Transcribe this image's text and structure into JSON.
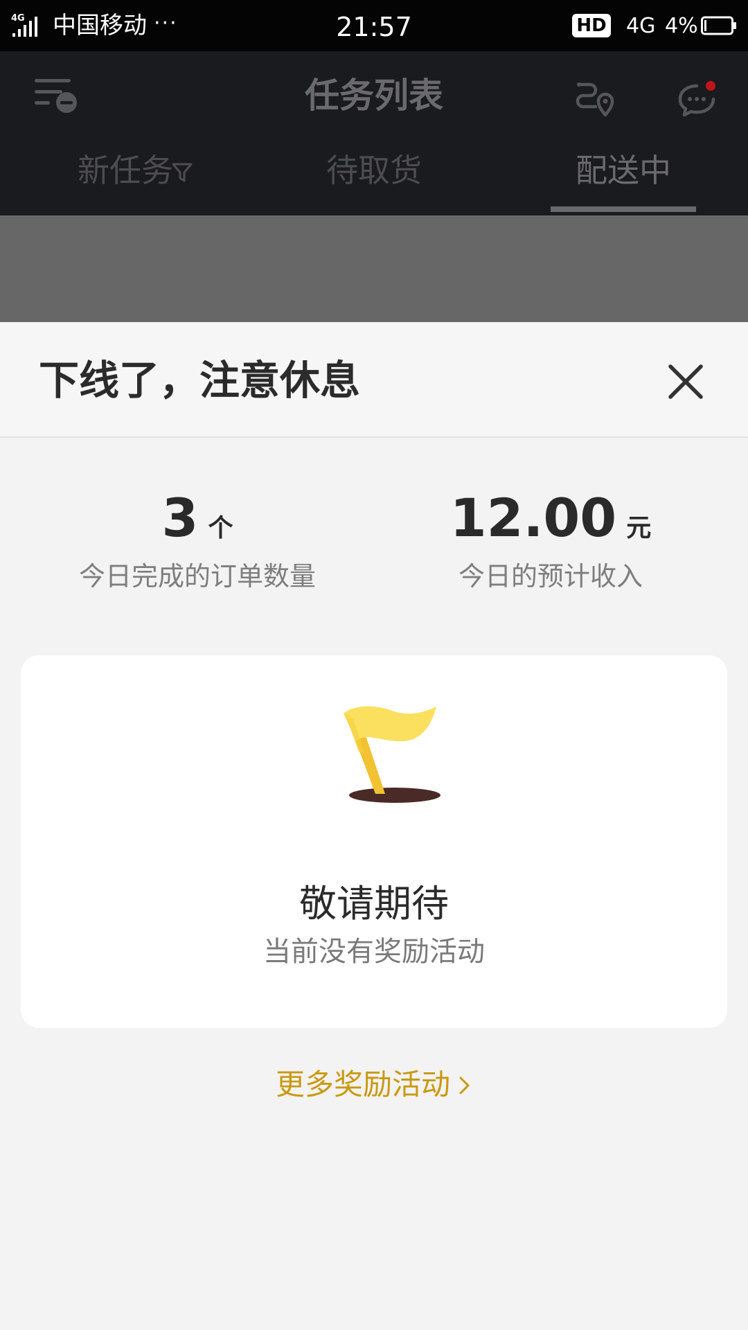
{
  "status_bar": {
    "network_tag": "4G",
    "carrier": "中国移动",
    "more": "···",
    "time": "21:57",
    "hd": "HD",
    "network": "4G",
    "battery": "4%"
  },
  "header": {
    "title": "任务列表",
    "tabs": [
      {
        "label": "新任务"
      },
      {
        "label": "待取货"
      },
      {
        "label": "配送中"
      }
    ],
    "active_tab": "配送中",
    "notification_dot_color": "#c0141b"
  },
  "sheet": {
    "title": "下线了，注意休息",
    "stats": {
      "orders": {
        "value": "3",
        "unit": "个",
        "label": "今日完成的订单数量"
      },
      "income": {
        "value": "12.00",
        "unit": "元",
        "label": "今日的预计收入"
      }
    },
    "card": {
      "title": "敬请期待",
      "subtitle": "当前没有奖励活动"
    },
    "more_link": "更多奖励活动"
  },
  "colors": {
    "header_bg": "#1a1b1f",
    "link": "#c9990f",
    "flag": "#f9d84a"
  }
}
